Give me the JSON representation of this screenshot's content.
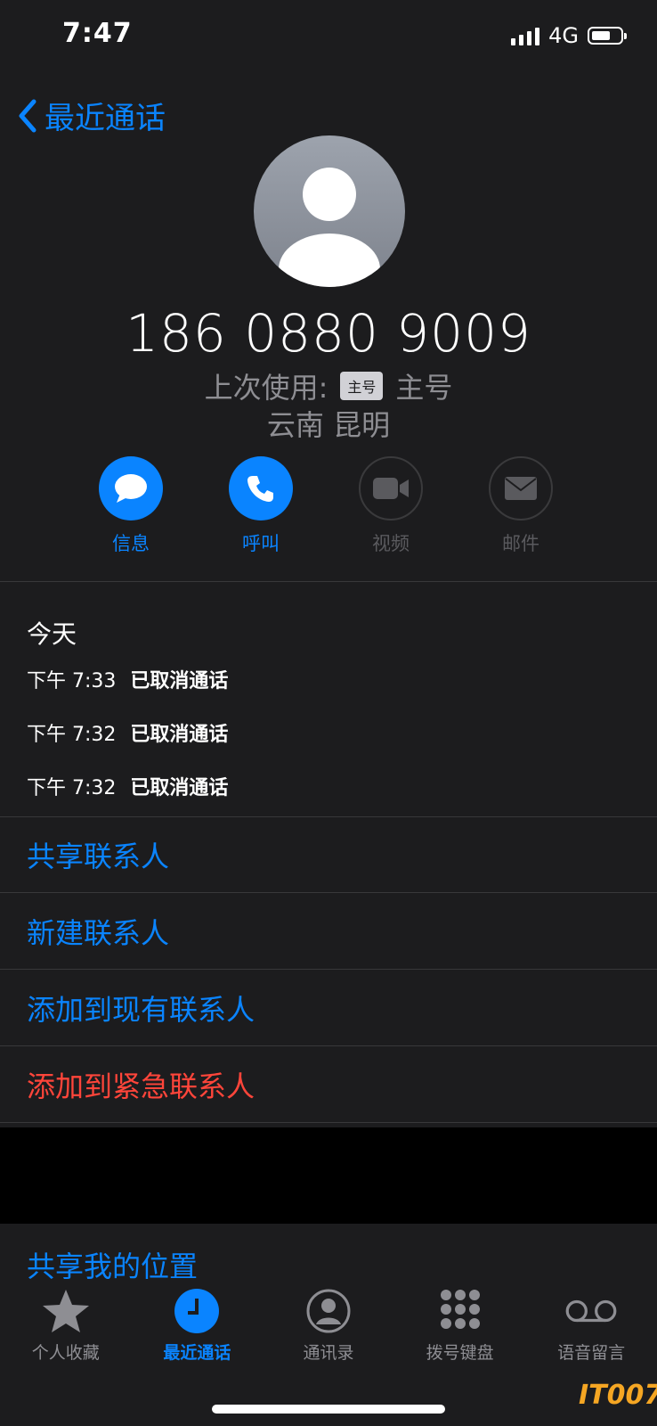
{
  "status_bar": {
    "time": "7:47",
    "network": "4G"
  },
  "nav": {
    "back_label": "最近通话"
  },
  "contact": {
    "phone_number": "186 0880 9009",
    "last_used_prefix": "上次使用:",
    "sim_badge": "主号",
    "sim_name": "主号",
    "location": "云南 昆明"
  },
  "actions": [
    {
      "label": "信息",
      "icon": "message-icon",
      "active": true
    },
    {
      "label": "呼叫",
      "icon": "phone-icon",
      "active": true
    },
    {
      "label": "视频",
      "icon": "video-icon",
      "active": false
    },
    {
      "label": "邮件",
      "icon": "mail-icon",
      "active": false
    }
  ],
  "calls": {
    "date": "今天",
    "entries": [
      {
        "time": "下午 7:33",
        "status": "已取消通话"
      },
      {
        "time": "下午 7:32",
        "status": "已取消通话"
      },
      {
        "time": "下午 7:32",
        "status": "已取消通话"
      }
    ]
  },
  "menu": [
    {
      "label": "共享联系人"
    },
    {
      "label": "新建联系人"
    },
    {
      "label": "添加到现有联系人"
    },
    {
      "label": "添加到紧急联系人"
    }
  ],
  "share_location": "共享我的位置",
  "tabs": [
    {
      "label": "个人收藏",
      "icon": "star-icon"
    },
    {
      "label": "最近通话",
      "icon": "clock-icon"
    },
    {
      "label": "通讯录",
      "icon": "contacts-icon"
    },
    {
      "label": "拨号键盘",
      "icon": "keypad-icon"
    },
    {
      "label": "语音留言",
      "icon": "voicemail-icon"
    }
  ],
  "watermark": "IT007",
  "colors": {
    "accent": "#0a84ff",
    "danger": "#ff453a",
    "background": "#1c1c1e"
  }
}
